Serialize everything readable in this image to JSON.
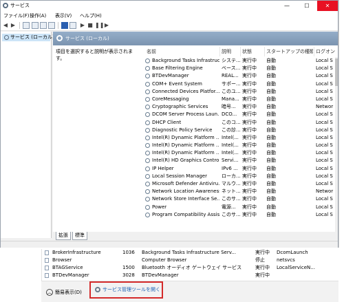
{
  "services_window": {
    "title": "サービス",
    "menu": [
      "ファイル(F)",
      "操作(A)",
      "表示(V)",
      "ヘルプ(H)"
    ],
    "tree_item": "サービス (ローカル)",
    "pane_title": "サービス (ローカル)",
    "description_text": "項目を選択すると説明が表示されます。",
    "columns": [
      "名前",
      "説明",
      "状態",
      "スタートアップの種類",
      "ログオン"
    ],
    "rows": [
      {
        "name": "Background Tasks Infrastructur...",
        "desc": "システ...",
        "status": "実行中",
        "startup": "自動",
        "logon": "Local S"
      },
      {
        "name": "Base Filtering Engine",
        "desc": "ベース...",
        "status": "実行中",
        "startup": "自動",
        "logon": "Local S"
      },
      {
        "name": "BTDevManager",
        "desc": "REAL...",
        "status": "実行中",
        "startup": "自動",
        "logon": "Local S"
      },
      {
        "name": "COM+ Event System",
        "desc": "サポー...",
        "status": "実行中",
        "startup": "自動",
        "logon": "Local S"
      },
      {
        "name": "Connected Devices Platfor...",
        "desc": "このユ...",
        "status": "実行中",
        "startup": "自動",
        "logon": "Local S"
      },
      {
        "name": "CoreMessaging",
        "desc": "Mana...",
        "status": "実行中",
        "startup": "自動",
        "logon": "Local S"
      },
      {
        "name": "Cryptographic Services",
        "desc": "暗号...",
        "status": "実行中",
        "startup": "自動",
        "logon": "Networ"
      },
      {
        "name": "DCOM Server Process Laun...",
        "desc": "DCO...",
        "status": "実行中",
        "startup": "自動",
        "logon": "Local S"
      },
      {
        "name": "DHCP Client",
        "desc": "このコ...",
        "status": "実行中",
        "startup": "自動",
        "logon": "Local S"
      },
      {
        "name": "Diagnostic Policy Service",
        "desc": "この診...",
        "status": "実行中",
        "startup": "自動",
        "logon": "Local S"
      },
      {
        "name": "Intel(R) Dynamic Platform ...",
        "desc": "Intel(...",
        "status": "実行中",
        "startup": "自動",
        "logon": "Local S"
      },
      {
        "name": "Intel(R) Dynamic Platform ...",
        "desc": "Intel(...",
        "status": "実行中",
        "startup": "自動",
        "logon": "Local S"
      },
      {
        "name": "Intel(R) Dynamic Platform ...",
        "desc": "Intel(...",
        "status": "実行中",
        "startup": "自動",
        "logon": "Local S"
      },
      {
        "name": "Intel(R) HD Graphics Contro...",
        "desc": "Servi...",
        "status": "実行中",
        "startup": "自動",
        "logon": "Local S"
      },
      {
        "name": "IP Helper",
        "desc": "IPv6 ...",
        "status": "実行中",
        "startup": "自動",
        "logon": "Local S"
      },
      {
        "name": "Local Session Manager",
        "desc": "ローカ...",
        "status": "実行中",
        "startup": "自動",
        "logon": "Local S"
      },
      {
        "name": "Microsoft Defender Antiviru...",
        "desc": "マルウ...",
        "status": "実行中",
        "startup": "自動",
        "logon": "Local S"
      },
      {
        "name": "Network Location Awareness",
        "desc": "ネット...",
        "status": "実行中",
        "startup": "自動",
        "logon": "Networ"
      },
      {
        "name": "Network Store Interface Se...",
        "desc": "このサ...",
        "status": "実行中",
        "startup": "自動",
        "logon": "Local S"
      },
      {
        "name": "Power",
        "desc": "電源...",
        "status": "実行中",
        "startup": "自動",
        "logon": "Local S"
      },
      {
        "name": "Program Compatibility Assis...",
        "desc": "このサ...",
        "status": "実行中",
        "startup": "自動",
        "logon": "Local S"
      }
    ],
    "tabs": [
      "拡張",
      "標準"
    ]
  },
  "task_manager": {
    "rows": [
      {
        "name": "BrokerInfrastructure",
        "pid": "1036",
        "desc": "Background Tasks Infrastructure Serv...",
        "status": "実行中",
        "group": "DcomLaunch"
      },
      {
        "name": "Browser",
        "pid": "",
        "desc": "Computer Browser",
        "status": "停止",
        "group": "netsvcs"
      },
      {
        "name": "BTAGService",
        "pid": "1500",
        "desc": "Bluetooth オーディオ ゲートウェイ サービス",
        "status": "実行中",
        "group": "LocalServiceN..."
      },
      {
        "name": "BTDevManager",
        "pid": "3028",
        "desc": "BTDevManager",
        "status": "実行中",
        "group": ""
      }
    ],
    "fewer_details": "簡易表示(D)",
    "open_services": "サービス管理ツールを開く"
  },
  "colors": {
    "highlight_border": "#d42a2a",
    "link": "#1a5fb4",
    "close_button": "#e81123"
  }
}
